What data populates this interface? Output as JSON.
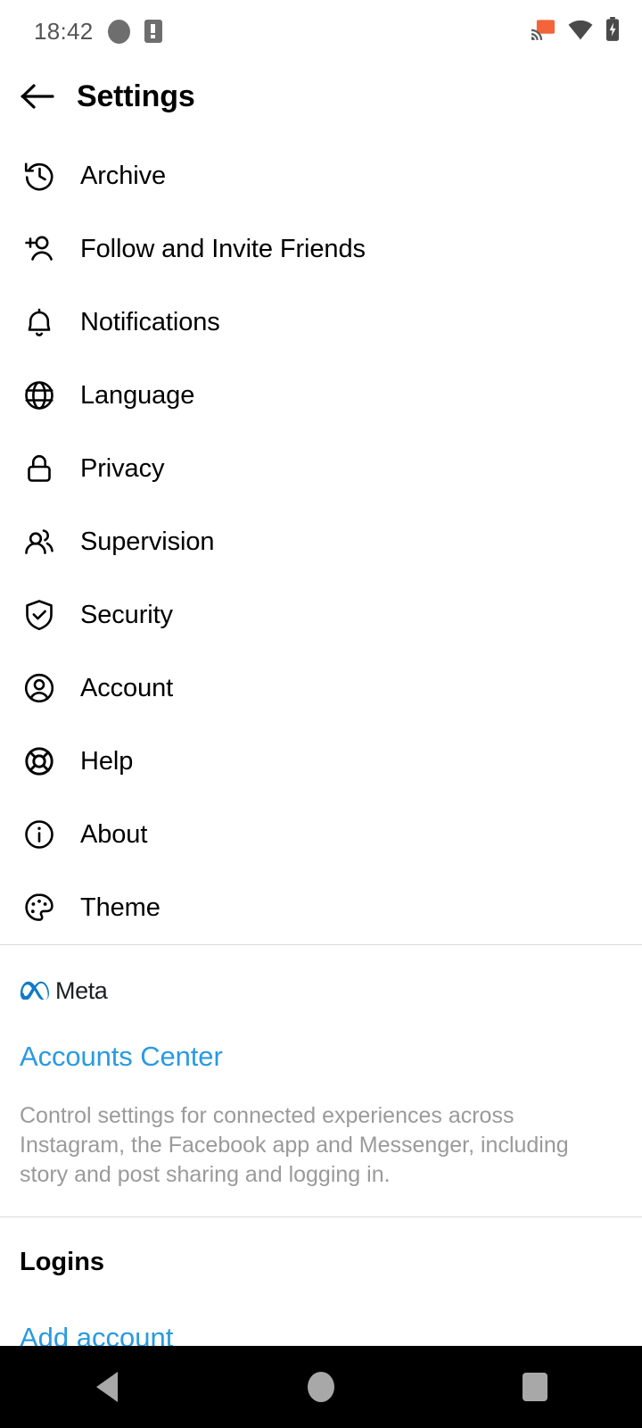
{
  "status_bar": {
    "time": "18:42",
    "icons": [
      "circle-indicator-icon",
      "sim-alert-icon",
      "cast-icon",
      "wifi-icon",
      "battery-charging-icon"
    ],
    "cast_color": "#f4633a",
    "text_color": "#555555"
  },
  "header": {
    "back_label": "back-arrow",
    "title": "Settings"
  },
  "settings": {
    "items": [
      {
        "label": "Archive",
        "icon": "archive-history-icon"
      },
      {
        "label": "Follow and Invite Friends",
        "icon": "person-add-icon"
      },
      {
        "label": "Notifications",
        "icon": "bell-icon"
      },
      {
        "label": "Language",
        "icon": "globe-icon"
      },
      {
        "label": "Privacy",
        "icon": "lock-icon"
      },
      {
        "label": "Supervision",
        "icon": "people-icon"
      },
      {
        "label": "Security",
        "icon": "shield-check-icon"
      },
      {
        "label": "Account",
        "icon": "account-circle-icon"
      },
      {
        "label": "Help",
        "icon": "lifebuoy-icon"
      },
      {
        "label": "About",
        "icon": "info-circle-icon"
      },
      {
        "label": "Theme",
        "icon": "palette-icon"
      }
    ]
  },
  "meta_section": {
    "brand_name": "Meta",
    "brand_color": "#0f7ac7",
    "accounts_center_label": "Accounts Center",
    "description": "Control settings for connected experiences across Instagram, the Facebook app and Messenger, including story and post sharing and logging in.",
    "link_color": "#2a9ae0"
  },
  "logins_section": {
    "title": "Logins",
    "add_account_label": "Add account"
  },
  "nav_bar": {
    "back": "nav-back-button",
    "home": "nav-home-button",
    "recents": "nav-recents-button",
    "icon_color": "#a8a8a8"
  }
}
